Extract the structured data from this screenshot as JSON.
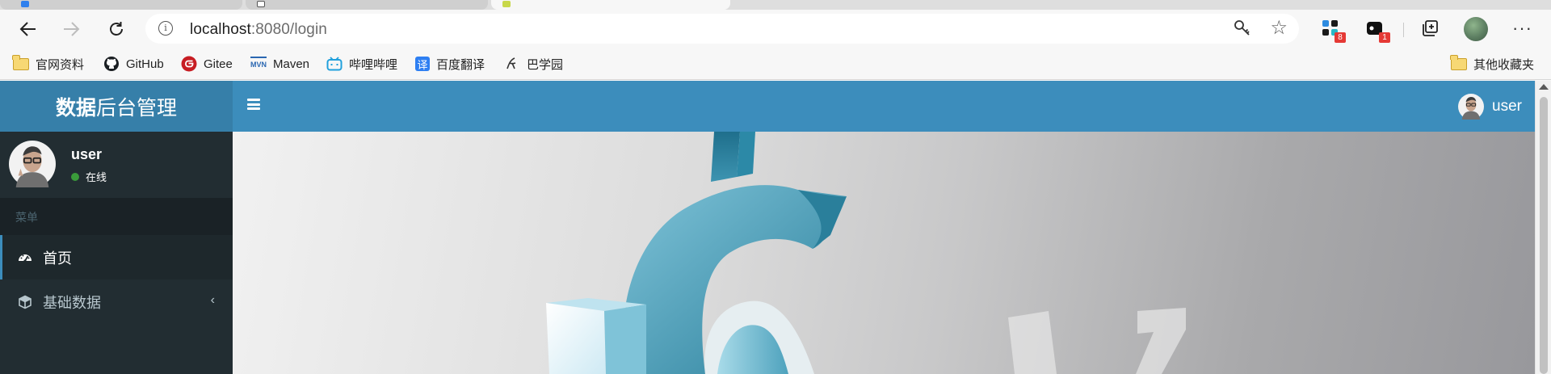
{
  "browser": {
    "address": {
      "host": "localhost",
      "rest": ":8080/login",
      "info_glyph": "i"
    },
    "extensions": [
      {
        "name": "extension-apps-icon",
        "badge": "8"
      },
      {
        "name": "extension-puzzle-icon",
        "badge": "1"
      }
    ],
    "more_label": "···",
    "bookmarks": [
      {
        "label": "官网资料",
        "icon": "folder-icon"
      },
      {
        "label": "GitHub",
        "icon": "github-icon"
      },
      {
        "label": "Gitee",
        "icon": "gitee-icon"
      },
      {
        "label": "Maven",
        "icon": "maven-icon"
      },
      {
        "label": "哔哩哔哩",
        "icon": "bilibili-icon"
      },
      {
        "label": "百度翻译",
        "icon": "baidu-translate-icon"
      },
      {
        "label": "巴学园",
        "icon": "baxueyuan-icon"
      }
    ],
    "other_bookmarks": "其他收藏夹",
    "maven_icon_text": "MVN",
    "translate_icon_text": "译"
  },
  "app": {
    "brand_bold": "数据",
    "brand_rest": "后台管理",
    "header_user": "user",
    "sidebar": {
      "user_name": "user",
      "status": "在线",
      "menu_header": "菜单",
      "items": [
        {
          "label": "首页",
          "icon": "dashboard-icon",
          "active": true
        },
        {
          "label": "基础数据",
          "icon": "cube-icon",
          "active": false,
          "expand_glyph": "‹"
        }
      ]
    },
    "content": {
      "image": "dollar-sign-hero-image"
    }
  },
  "colors": {
    "header_brand": "#367fa9",
    "header": "#3c8dbc",
    "sidebar": "#222d32",
    "online": "#3a9b3a"
  }
}
